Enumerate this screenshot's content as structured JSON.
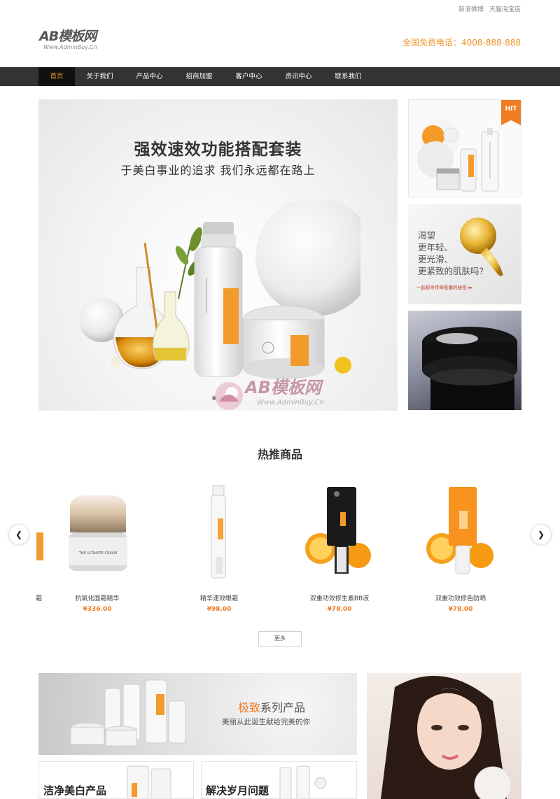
{
  "topbar": {
    "links": [
      "新浪微博",
      "天猫淘宝店"
    ]
  },
  "logo": {
    "mark": "AB模板网",
    "sub": "Www.AdminBuy.Cn"
  },
  "hotline": "全国免费电话：4008-888-888",
  "nav": {
    "items": [
      "首页",
      "关于我们",
      "产品中心",
      "招商加盟",
      "客户中心",
      "资讯中心",
      "联系我们"
    ],
    "active_index": 0
  },
  "hero": {
    "title": "强效速效功能搭配套装",
    "subtitle": "于美白事业的追求  我们永远都在路上"
  },
  "watermark": {
    "text": "AB模板网",
    "sub": "Www.AdminBuy.Cn"
  },
  "side_banners": {
    "hit_tag": "HIT",
    "text_lines": [
      "渴望",
      "更年轻、",
      "更光滑、",
      "更紧致的肌肤吗？"
    ],
    "small_text": "一起探寻传奇胶囊的秘密 ▸▸"
  },
  "hot_products": {
    "title": "热推商品",
    "partial_name": "霜",
    "items": [
      {
        "name": "抗氧化面霜精华",
        "price": "¥336.00"
      },
      {
        "name": "精华速效眼霜",
        "price": "¥98.00"
      },
      {
        "name": "双重功效修生素BB液",
        "price": "¥78.00"
      },
      {
        "name": "双重功效修色防晒",
        "price": "¥78.00"
      }
    ],
    "more_label": "更多",
    "prev_icon": "chevron-left-icon",
    "next_icon": "chevron-right-icon"
  },
  "bottom": {
    "series_title_accent": "极致",
    "series_title_rest": "系列产品",
    "series_sub": "美丽从此诞生献给完美的你",
    "cards": [
      "洁净美白产品",
      "解决岁月问题"
    ]
  },
  "colors": {
    "accent": "#f07c23",
    "nav_bg": "#333333",
    "nav_active_bg": "#111111"
  }
}
